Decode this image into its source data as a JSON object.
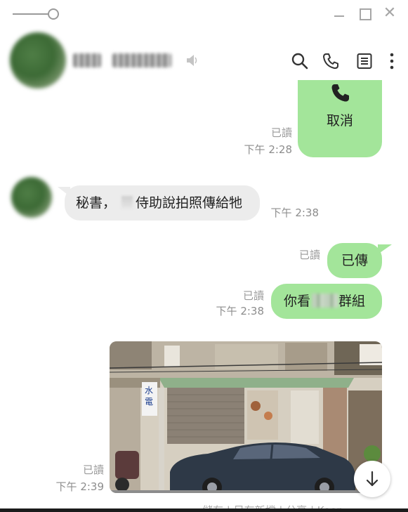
{
  "window": {
    "controls": [
      "pin-slider-icon",
      "minimize-icon",
      "maximize-icon",
      "close-icon"
    ],
    "close_glyph": "✕"
  },
  "header": {
    "icons": [
      "speaker-icon",
      "search-icon",
      "phone-icon",
      "notes-icon",
      "more-icon"
    ]
  },
  "messages": [
    {
      "id": "call",
      "direction": "out",
      "icon": "phone-icon",
      "text": "取消",
      "read": "已讀",
      "time": "下午 2:28"
    },
    {
      "id": "in1",
      "direction": "in",
      "text_prefix": "秘書，",
      "text_suffix": "侍助說拍照傳給牠",
      "time": "下午 2:38"
    },
    {
      "id": "out1",
      "direction": "out",
      "text": "已傳",
      "read": "已讀"
    },
    {
      "id": "out2",
      "direction": "out",
      "text_prefix": "你看",
      "text_suffix": "群組",
      "read": "已讀",
      "time": "下午 2:38"
    },
    {
      "id": "photo",
      "direction": "out",
      "type": "image",
      "image_sign_text": "水電",
      "read": "已讀",
      "time": "下午 2:39"
    }
  ],
  "photo_actions": "儲存 | 另存新檔 | 分享 | Keep",
  "colors": {
    "outgoing_bubble": "#a3e59a",
    "incoming_bubble": "#ececec",
    "meta_text": "#9a9a9a",
    "icon": "#333333"
  }
}
